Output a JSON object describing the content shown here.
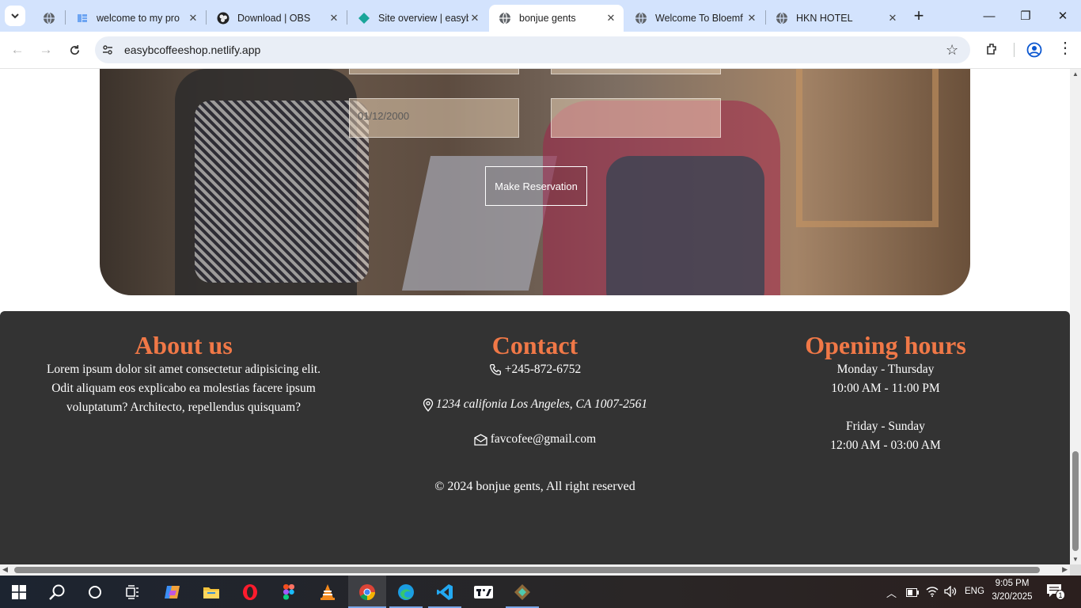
{
  "browser": {
    "tabs": [
      {
        "title": "",
        "icon": "globe-icon"
      },
      {
        "title": "welcome to my pro",
        "icon": "page-icon"
      },
      {
        "title": "Download | OBS",
        "icon": "obs-icon"
      },
      {
        "title": "Site overview | easyb",
        "icon": "netlify-icon"
      },
      {
        "title": "bonjue gents",
        "icon": "globe-icon",
        "active": true
      },
      {
        "title": "Welcome To Bloemf",
        "icon": "globe-icon"
      },
      {
        "title": "HKN HOTEL",
        "icon": "globe-icon"
      }
    ],
    "url": "easybcoffeeshop.netlify.app"
  },
  "reservation": {
    "date_value": "01/12/2000",
    "button_label": "Make Reservation"
  },
  "footer": {
    "about": {
      "heading": "About us",
      "text": "Lorem ipsum dolor sit amet consectetur adipisicing elit. Odit aliquam eos explicabo ea molestias facere ipsum voluptatum? Architecto, repellendus quisquam?"
    },
    "contact": {
      "heading": "Contact",
      "phone": "+245-872-6752",
      "address": "1234 califonia Los Angeles, CA 1007-2561",
      "email": "favcofee@gmail.com"
    },
    "hours": {
      "heading": "Opening hours",
      "weekday_label": "Monday - Thursday",
      "weekday_time": "10:00 AM - 11:00 PM",
      "weekend_label": "Friday - Sunday",
      "weekend_time": "12:00 AM - 03:00 AM"
    },
    "copyright": "© 2024 bonjue gents, All right reserved"
  },
  "taskbar": {
    "language": "ENG",
    "time": "9:05 PM",
    "date": "3/20/2025",
    "notifications": "1"
  },
  "colors": {
    "accent": "#f07847",
    "footer_bg": "#333333",
    "tabbar_bg": "#d3e3fd"
  }
}
